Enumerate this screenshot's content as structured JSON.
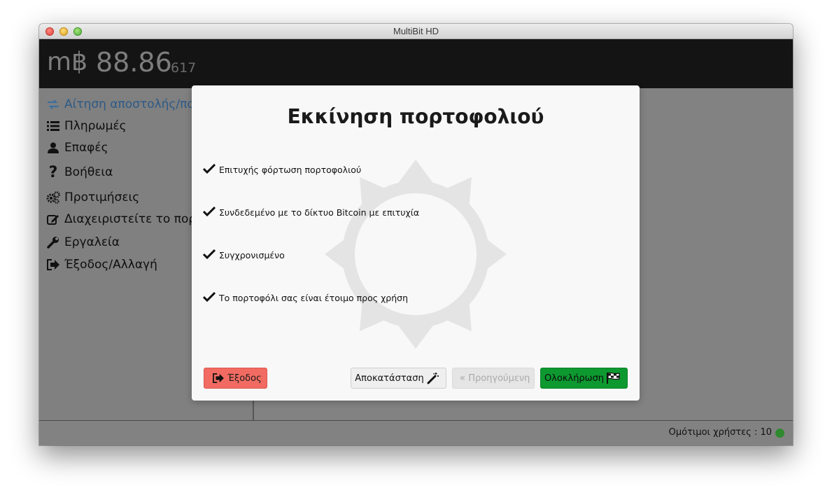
{
  "window": {
    "title": "MultiBit HD"
  },
  "balance": {
    "symbol": "m฿",
    "main": "88.86",
    "small": "617"
  },
  "sidebar": {
    "items": [
      {
        "label": "Αίτηση αποστολής/πο",
        "icon": "exchange-icon",
        "active": true
      },
      {
        "label": "Πληρωμές",
        "icon": "list-icon"
      },
      {
        "label": "Επαφές",
        "icon": "user-icon"
      },
      {
        "label": "Βοήθεια",
        "icon": "question-icon"
      },
      {
        "label": "Προτιμήσεις",
        "icon": "gears-icon"
      },
      {
        "label": "Διαχειριστείτε το πορτ",
        "icon": "edit-icon"
      },
      {
        "label": "Εργαλεία",
        "icon": "wrench-icon"
      },
      {
        "label": "Έξοδος/Αλλαγή",
        "icon": "sign-out-icon"
      }
    ]
  },
  "modal": {
    "title": "Εκκίνηση πορτοφολιού",
    "checks": [
      "Επιτυχής φόρτωση πορτοφολιού",
      "Συνδεδεμένο με το δίκτυο Bitcoin με επιτυχία",
      "Συγχρονισμένο",
      "Το πορτοφόλι σας είναι έτοιμο προς χρήση"
    ],
    "buttons": {
      "exit": "Έξοδος",
      "restore": "Αποκατάσταση",
      "previous": "Προηγούμενη",
      "finish": "Ολοκλήρωση"
    },
    "watermark_icon": "sun-icon",
    "check_icon": "checkmark-icon"
  },
  "status": {
    "peers_text": "Ομότιμοι χρήστες : 10",
    "indicator_color": "#2f8a2f"
  },
  "colors": {
    "exit_button": "#f26b62",
    "finish_button": "#0d9930",
    "active_nav": "#2c5a86"
  }
}
